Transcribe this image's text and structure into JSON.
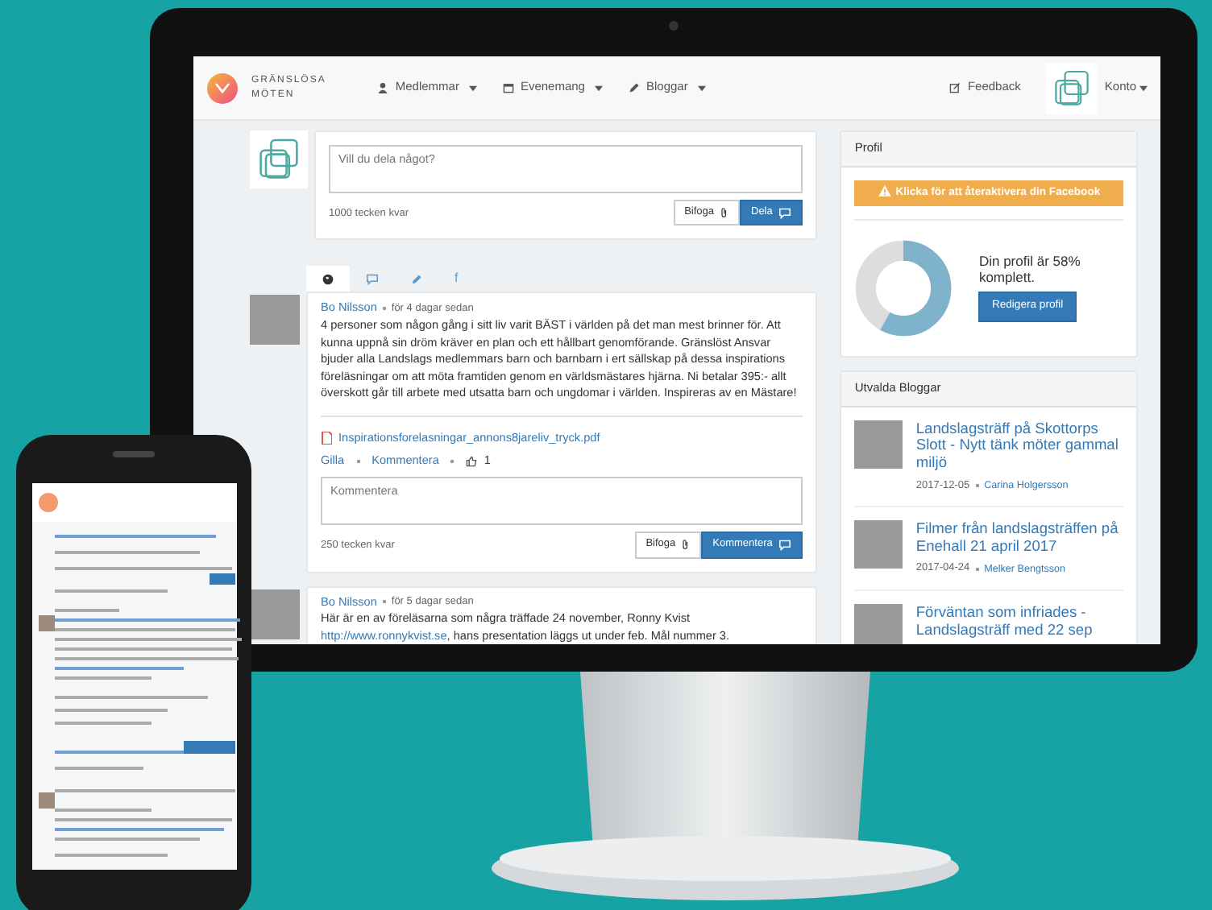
{
  "navbar": {
    "brand": [
      "GRÄNSLÖSA",
      "MÖTEN"
    ],
    "menus": [
      {
        "kind": "user",
        "label": "Medlemmar"
      },
      {
        "kind": "calendar",
        "label": "Evenemang"
      },
      {
        "kind": "pencil",
        "label": "Bloggar"
      }
    ],
    "feedback": "Feedback",
    "account": "Konto"
  },
  "composer": {
    "placeholder": "Vill du dela något?",
    "counter": "1000 tecken kvar",
    "attach": "Bifoga",
    "share": "Dela"
  },
  "feed_tabs": [
    {
      "kind": "globe",
      "selected": true
    },
    {
      "kind": "comment",
      "selected": false
    },
    {
      "kind": "pencil",
      "selected": false
    },
    {
      "kind": "text",
      "label": "f",
      "selected": false
    }
  ],
  "posts": [
    {
      "author": "Bo Nilsson",
      "time": "för 4 dagar sedan",
      "text": [
        "4 personer som någon gång i sitt liv varit BÄST i världen på det man mest brinner för. Att kunna uppnå sin dröm kräver en plan och ett hållbart genomförande. Gränslöst Ansvar bjuder alla Landslags medlemmars barn och barnbarn i ert sällskap på dessa inspirations föreläsningar om att möta framtiden genom en världsmästares hjärna. Ni betalar 395:- allt överskott går till arbete med utsatta barn och ungdomar i världen. Inspireras av en Mästare!"
      ],
      "attachment": "Inspirationsforelasningar_annons8jareliv_tryck.pdf",
      "like": "Gilla",
      "comment": "Kommentera",
      "likes": "1",
      "comment_form": {
        "placeholder": "Kommentera",
        "counter": "250 tecken kvar",
        "attach": "Bifoga",
        "submit": "Kommentera"
      }
    },
    {
      "author": "Bo Nilsson",
      "time": "för 5 dagar sedan",
      "text": [
        "Här är en av föreläsarna som några träffade 24 november, Ronny Kvist",
        {
          "link": "http://www.ronnykvist.se"
        },
        ", hans presentation läggs ut under feb. Mål nummer 3."
      ]
    }
  ],
  "profile": {
    "title": "Profil",
    "alert": "Klicka för att återaktivera din Facebook",
    "level": 0.58,
    "status": "Din profil är 58% komplett.",
    "edit": "Redigera profil"
  },
  "blogs": {
    "title": "Utvalda Bloggar",
    "items": [
      {
        "title": "Landslagsträff på Skottorps Slott - Nytt tänk möter gammal miljö",
        "date": "2017-12-05",
        "author": "Carina Holgersson"
      },
      {
        "title": "Filmer från landslagsträffen på Enehall 21 april 2017",
        "date": "2017-04-24",
        "author": "Melker Bengtsson"
      },
      {
        "title": "Förväntan som infriades - Landslagsträff med 22 sep"
      }
    ]
  }
}
